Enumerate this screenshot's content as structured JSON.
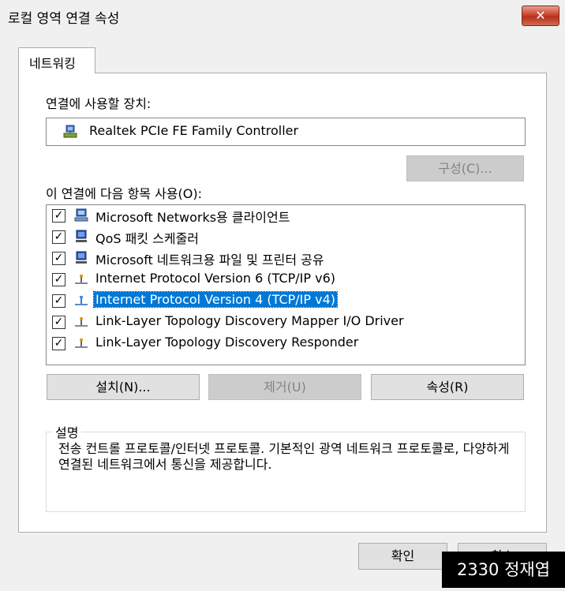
{
  "window": {
    "title": "로컬 영역 연결 속성",
    "close_label": "✕"
  },
  "tab": {
    "label": "네트워킹"
  },
  "connect_using_label": "연결에 사용할 장치:",
  "device": {
    "name": "Realtek PCIe FE Family Controller",
    "icon": "network-adapter-icon"
  },
  "configure_label": "구성(C)...",
  "items_label": "이 연결에 다음 항목 사용(O):",
  "items": [
    {
      "label": "Microsoft Networks용 클라이언트",
      "checked": true,
      "icon": "network-client-icon"
    },
    {
      "label": "QoS 패킷 스케줄러",
      "checked": true,
      "icon": "service-icon"
    },
    {
      "label": "Microsoft 네트워크용 파일 및 프린터 공유",
      "checked": true,
      "icon": "service-icon"
    },
    {
      "label": "Internet Protocol Version 6 (TCP/IP v6)",
      "checked": true,
      "icon": "protocol-icon"
    },
    {
      "label": "Internet Protocol Version 4 (TCP/IP v4)",
      "checked": true,
      "icon": "protocol-icon",
      "selected": true
    },
    {
      "label": "Link-Layer Topology Discovery Mapper I/O Driver",
      "checked": true,
      "icon": "protocol-icon"
    },
    {
      "label": "Link-Layer Topology Discovery Responder",
      "checked": true,
      "icon": "protocol-icon"
    }
  ],
  "buttons": {
    "install": "설치(N)...",
    "uninstall": "제거(U)",
    "properties": "속성(R)"
  },
  "description": {
    "title": "설명",
    "text": "전송 컨트롤 프로토콜/인터넷 프로토콜. 기본적인 광역 네트워크 프로토콜로, 다양하게 연결된 네트워크에서 통신을 제공합니다."
  },
  "footer": {
    "ok": "확인",
    "cancel": "취소"
  },
  "watermark": "2330 정재엽",
  "colors": {
    "selection": "#0078d7",
    "close": "#c9432f"
  }
}
